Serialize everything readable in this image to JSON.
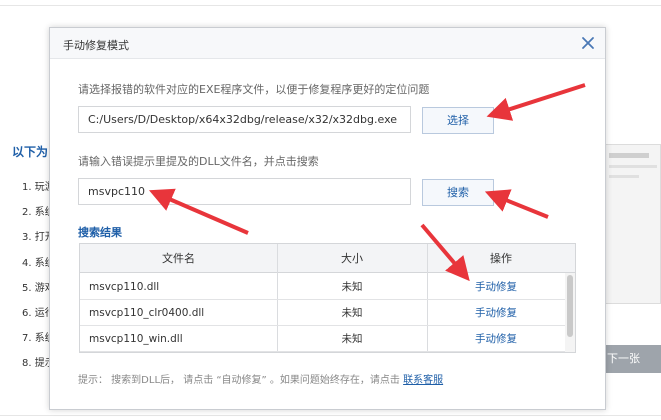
{
  "background": {
    "heading": "以下为",
    "list_items": [
      "1. 玩游",
      "2. 系统",
      "3. 打开",
      "4. 系统",
      "5. 游戏",
      "6. 运行",
      "7. 系统",
      "8. 提示"
    ],
    "next_button": "下一张"
  },
  "dialog": {
    "title": "手动修复模式",
    "exe_instruction": "请选择报错的软件对应的EXE程序文件，以便于修复程序更好的定位问题",
    "exe_path": "C:/Users/D/Desktop/x64x32dbg/release/x32/x32dbg.exe",
    "choose_button": "选择",
    "dll_instruction": "请输入错误提示里提及的DLL文件名，并点击搜索",
    "dll_input_value": "msvpc110",
    "search_button": "搜索",
    "results_label": "搜索结果",
    "table": {
      "headers": [
        "文件名",
        "大小",
        "操作"
      ],
      "rows": [
        {
          "filename": "msvcp110.dll",
          "size": "未知",
          "action": "手动修复"
        },
        {
          "filename": "msvcp110_clr0400.dll",
          "size": "未知",
          "action": "手动修复"
        },
        {
          "filename": "msvcp110_win.dll",
          "size": "未知",
          "action": "手动修复"
        }
      ]
    },
    "tip_text": "提示：  搜索到DLL后，  请点击 “自动修复” 。如果问题始终存在，请点击",
    "tip_link": "联系客服"
  },
  "colors": {
    "accent": "#1f5fa8",
    "annotation_arrow": "#e8353b"
  }
}
